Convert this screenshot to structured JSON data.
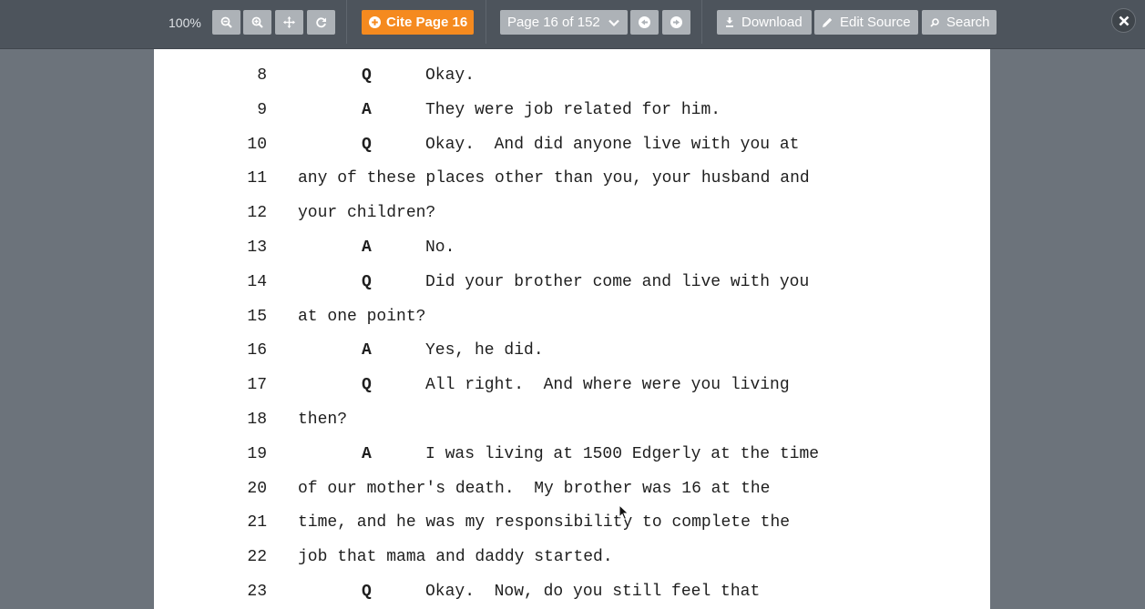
{
  "toolbar": {
    "zoom_level": "100%",
    "zoom_out_icon": "zoom-out-icon",
    "zoom_in_icon": "zoom-in-icon",
    "fit_icon": "move-arrows-icon",
    "rotate_icon": "rotate-icon",
    "cite_label": "Cite Page 16",
    "page_select_value": "Page 16 of 152",
    "download_label": "Download",
    "edit_source_label": "Edit Source",
    "search_label": "Search",
    "accent_color": "#f58a1f"
  },
  "transcript": {
    "lines": [
      {
        "num": "8",
        "speaker": "Q",
        "text": "Okay."
      },
      {
        "num": "9",
        "speaker": "A",
        "text": "They were job related for him."
      },
      {
        "num": "10",
        "speaker": "Q",
        "text": "Okay.  And did anyone live with you at"
      },
      {
        "num": "11",
        "speaker": "",
        "text": "any of these places other than you, your husband and"
      },
      {
        "num": "12",
        "speaker": "",
        "text": "your children?"
      },
      {
        "num": "13",
        "speaker": "A",
        "text": "No."
      },
      {
        "num": "14",
        "speaker": "Q",
        "text": "Did your brother come and live with you"
      },
      {
        "num": "15",
        "speaker": "",
        "text": "at one point?"
      },
      {
        "num": "16",
        "speaker": "A",
        "text": "Yes, he did."
      },
      {
        "num": "17",
        "speaker": "Q",
        "text": "All right.  And where were you living"
      },
      {
        "num": "18",
        "speaker": "",
        "text": "then?"
      },
      {
        "num": "19",
        "speaker": "A",
        "text": "I was living at 1500 Edgerly at the time"
      },
      {
        "num": "20",
        "speaker": "",
        "text": "of our mother's death.  My brother was 16 at the"
      },
      {
        "num": "21",
        "speaker": "",
        "text": "time, and he was my responsibility to complete the"
      },
      {
        "num": "22",
        "speaker": "",
        "text": "job that mama and daddy started."
      },
      {
        "num": "23",
        "speaker": "Q",
        "text": "Okay.  Now, do you still feel that"
      }
    ]
  }
}
